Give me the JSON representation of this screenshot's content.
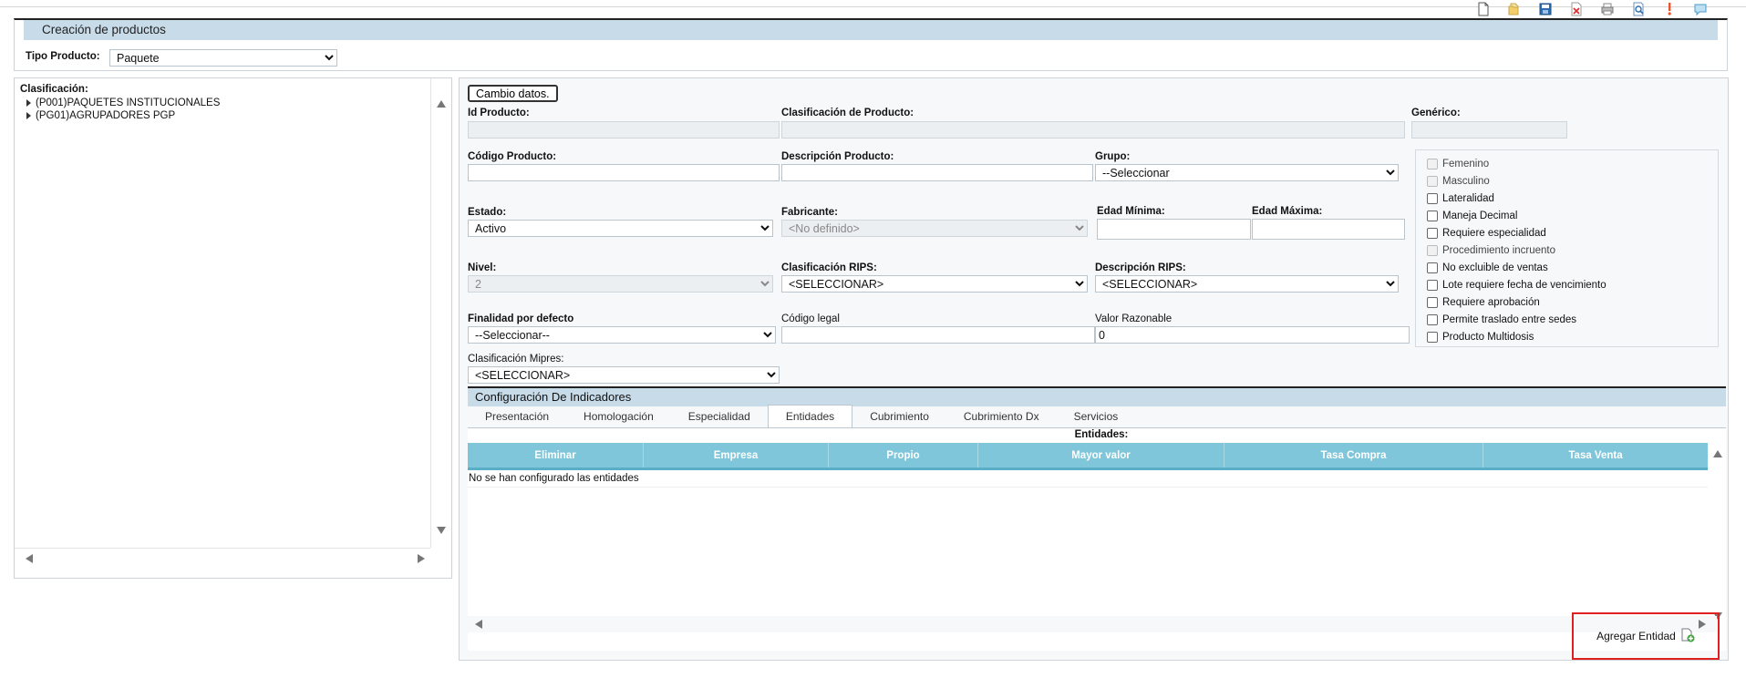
{
  "toolbar": {
    "icons": [
      "new-document-icon",
      "open-folder-icon",
      "save-icon",
      "delete-icon",
      "print-icon",
      "preview-icon",
      "alert-icon",
      "chat-icon"
    ]
  },
  "header": {
    "title": "Creación de productos",
    "tipo_producto_label": "Tipo Producto:",
    "tipo_producto_value": "Paquete"
  },
  "tree": {
    "label": "Clasificación:",
    "items": [
      {
        "label": "(P001)PAQUETES INSTITUCIONALES"
      },
      {
        "label": "(PG01)AGRUPADORES PGP"
      }
    ]
  },
  "form": {
    "cambio_datos_button": "Cambio datos.",
    "id_producto_label": "Id Producto:",
    "clasificacion_producto_label": "Clasificación de Producto:",
    "generico_label": "Genérico:",
    "codigo_producto_label": "Código Producto:",
    "descripcion_producto_label": "Descripción Producto:",
    "grupo_label": "Grupo:",
    "grupo_value": "--Seleccionar",
    "estado_label": "Estado:",
    "estado_value": "Activo",
    "fabricante_label": "Fabricante:",
    "fabricante_value": "<No definido>",
    "edad_minima_label": "Edad Mínima:",
    "edad_maxima_label": "Edad Máxima:",
    "nivel_label": "Nivel:",
    "nivel_value": "2",
    "clasificacion_rips_label": "Clasificación RIPS:",
    "clasificacion_rips_value": "<SELECCIONAR>",
    "descripcion_rips_label": "Descripción RIPS:",
    "descripcion_rips_value": "<SELECCIONAR>",
    "finalidad_label": "Finalidad por defecto",
    "finalidad_value": "--Seleccionar--",
    "codigo_legal_label": "Código legal",
    "valor_razonable_label": "Valor Razonable",
    "valor_razonable_value": "0",
    "clasificacion_mipres_label": "Clasificación Mipres:",
    "clasificacion_mipres_value": "<SELECCIONAR>"
  },
  "checkboxes": [
    {
      "label": "Femenino",
      "disabled": true
    },
    {
      "label": "Masculino",
      "disabled": true
    },
    {
      "label": "Lateralidad",
      "disabled": false
    },
    {
      "label": "Maneja Decimal",
      "disabled": false
    },
    {
      "label": "Requiere especialidad",
      "disabled": false
    },
    {
      "label": "Procedimiento incruento",
      "disabled": true
    },
    {
      "label": "No excluible de ventas",
      "disabled": false
    },
    {
      "label": "Lote requiere fecha de vencimiento",
      "disabled": false
    },
    {
      "label": "Requiere aprobación",
      "disabled": false
    },
    {
      "label": "Permite traslado entre sedes",
      "disabled": false
    },
    {
      "label": "Producto Multidosis",
      "disabled": false
    }
  ],
  "indicadores": {
    "title": "Configuración De Indicadores",
    "tabs": [
      {
        "label": "Presentación",
        "active": false
      },
      {
        "label": "Homologación",
        "active": false
      },
      {
        "label": "Especialidad",
        "active": false
      },
      {
        "label": "Entidades",
        "active": true
      },
      {
        "label": "Cubrimiento",
        "active": false
      },
      {
        "label": "Cubrimiento Dx",
        "active": false
      },
      {
        "label": "Servicios",
        "active": false
      }
    ],
    "grid_title": "Entidades:",
    "columns": [
      "Eliminar",
      "Empresa",
      "Propio",
      "Mayor valor",
      "Tasa Compra",
      "Tasa Venta"
    ],
    "empty_message": "No se han configurado las entidades",
    "add_button": "Agregar Entidad"
  },
  "colors": {
    "header_bg": "#c8dbe9",
    "grid_header_bg": "#7fc6da",
    "highlight": "#e02020"
  }
}
